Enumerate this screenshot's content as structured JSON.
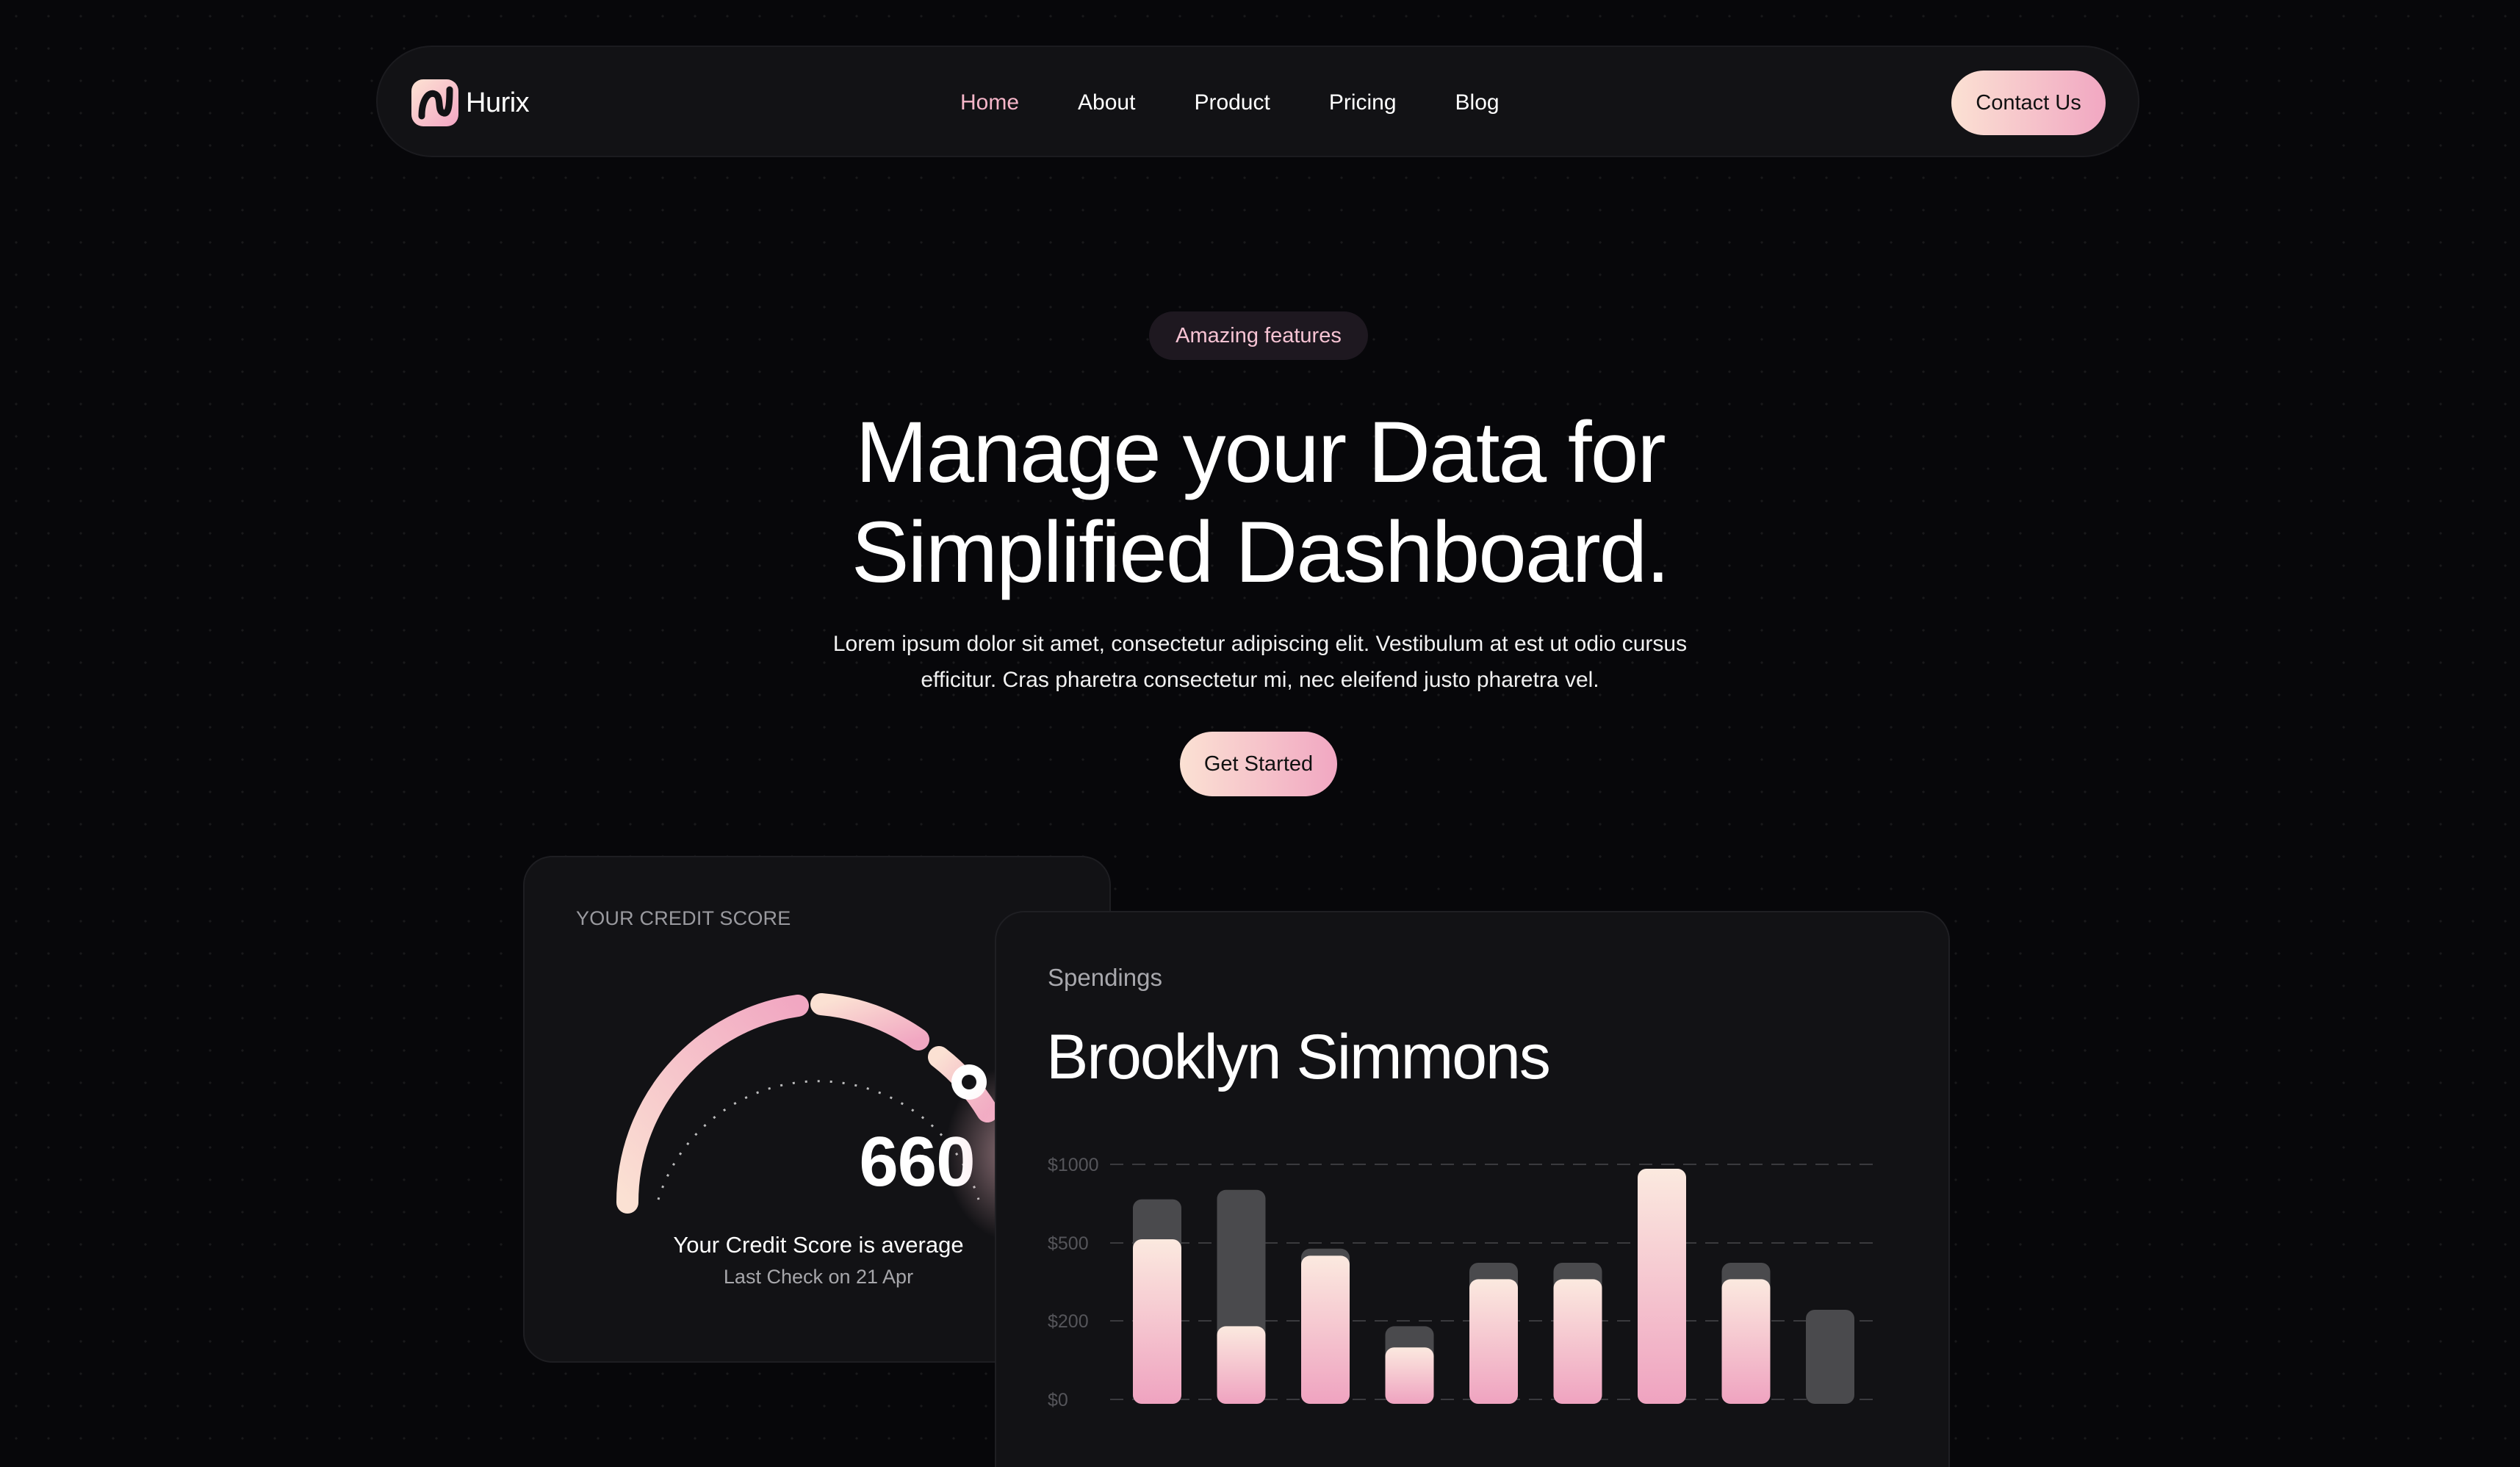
{
  "nav": {
    "brand": "Hurix",
    "links": [
      "Home",
      "About",
      "Product",
      "Pricing",
      "Blog"
    ],
    "active_link": "Home",
    "contact_label": "Contact Us"
  },
  "hero": {
    "badge": "Amazing features",
    "headline_line1": "Manage your Data for",
    "headline_line2": "Simplified Dashboard.",
    "subtext_line1": "Lorem ipsum dolor sit amet, consectetur adipiscing elit. Vestibulum at est ut odio cursus",
    "subtext_line2": "efficitur. Cras pharetra consectetur mi, nec eleifend justo pharetra vel.",
    "cta_label": "Get Started"
  },
  "credit": {
    "title": "YOUR CREDIT SCORE",
    "score": "660",
    "caption": "Your Credit Score is average",
    "last_check": "Last Check on 21 Apr",
    "gauge_fraction": 0.72
  },
  "spendings": {
    "label": "Spendings",
    "name": "Brooklyn Simmons"
  },
  "colors": {
    "accent_light": "#fbe1d3",
    "accent_pink": "#f1a7c2",
    "bar_track": "#4a4a4d"
  },
  "chart_data": {
    "type": "bar",
    "yticks": [
      "$1000",
      "$500",
      "$200",
      "$0"
    ],
    "ylim": [
      0,
      1000
    ],
    "categories": [],
    "series": [
      {
        "values": [
          700,
          330,
          630,
          240,
          530,
          530,
          1000,
          530,
          0
        ]
      },
      {
        "values": [
          870,
          910,
          660,
          330,
          600,
          600,
          1000,
          600,
          400
        ]
      }
    ]
  }
}
